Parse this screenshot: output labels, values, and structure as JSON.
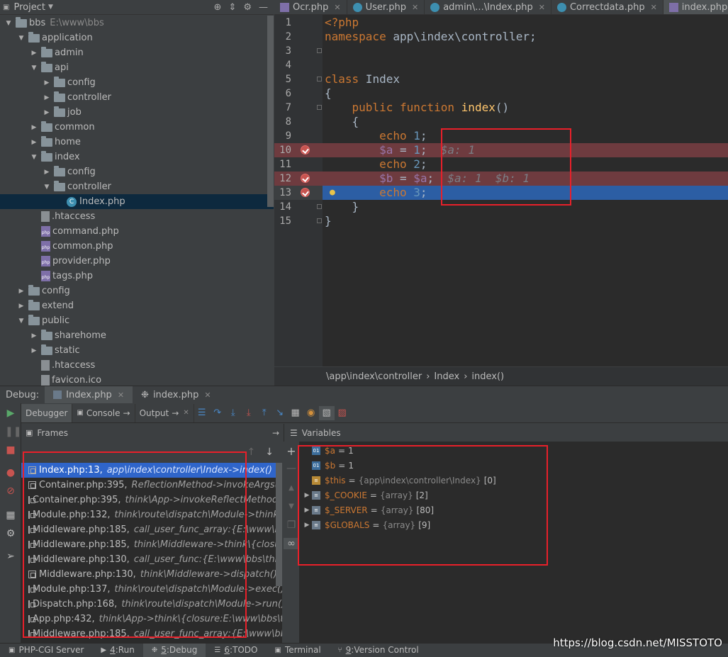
{
  "project": {
    "title": "Project",
    "tree": [
      {
        "label": "bbs",
        "path": "E:\\www\\bbs",
        "kind": "folder",
        "depth": 0,
        "open": true
      },
      {
        "label": "application",
        "kind": "folder",
        "depth": 1,
        "open": true
      },
      {
        "label": "admin",
        "kind": "folder",
        "depth": 2,
        "open": false
      },
      {
        "label": "api",
        "kind": "folder",
        "depth": 2,
        "open": true
      },
      {
        "label": "config",
        "kind": "folder",
        "depth": 3,
        "open": false
      },
      {
        "label": "controller",
        "kind": "folder",
        "depth": 3,
        "open": false
      },
      {
        "label": "job",
        "kind": "folder",
        "depth": 3,
        "open": false
      },
      {
        "label": "common",
        "kind": "folder",
        "depth": 2,
        "open": false
      },
      {
        "label": "home",
        "kind": "folder",
        "depth": 2,
        "open": false
      },
      {
        "label": "index",
        "kind": "folder",
        "depth": 2,
        "open": true
      },
      {
        "label": "config",
        "kind": "folder",
        "depth": 3,
        "open": false
      },
      {
        "label": "controller",
        "kind": "folder",
        "depth": 3,
        "open": true
      },
      {
        "label": "Index.php",
        "kind": "class",
        "depth": 4,
        "selected": true
      },
      {
        "label": ".htaccess",
        "kind": "ht",
        "depth": 2
      },
      {
        "label": "command.php",
        "kind": "php",
        "depth": 2
      },
      {
        "label": "common.php",
        "kind": "php",
        "depth": 2
      },
      {
        "label": "provider.php",
        "kind": "php",
        "depth": 2
      },
      {
        "label": "tags.php",
        "kind": "php",
        "depth": 2
      },
      {
        "label": "config",
        "kind": "folder",
        "depth": 1,
        "open": false
      },
      {
        "label": "extend",
        "kind": "folder",
        "depth": 1,
        "open": false
      },
      {
        "label": "public",
        "kind": "folder",
        "depth": 1,
        "open": true
      },
      {
        "label": "sharehome",
        "kind": "folder",
        "depth": 2,
        "open": false
      },
      {
        "label": "static",
        "kind": "folder",
        "depth": 2,
        "open": false
      },
      {
        "label": ".htaccess",
        "kind": "ht",
        "depth": 2
      },
      {
        "label": "favicon.ico",
        "kind": "ht",
        "depth": 2
      }
    ]
  },
  "editor": {
    "tabs": [
      {
        "label": "Ocr.php",
        "icon": "php",
        "active": false
      },
      {
        "label": "User.php",
        "icon": "c",
        "active": false
      },
      {
        "label": "admin\\...\\Index.php",
        "icon": "c",
        "active": false
      },
      {
        "label": "Correctdata.php",
        "icon": "c",
        "active": false
      },
      {
        "label": "index.php",
        "icon": "php",
        "active": true
      }
    ],
    "lines": [
      {
        "n": "1",
        "html": "<span class='kw'>&lt;?php</span>"
      },
      {
        "n": "2",
        "html": "<span class='kw'>namespace</span> app\\index\\controller;"
      },
      {
        "n": "3",
        "html": ""
      },
      {
        "n": "4",
        "html": ""
      },
      {
        "n": "5",
        "html": "<span class='kw'>class</span> Index"
      },
      {
        "n": "6",
        "html": "{"
      },
      {
        "n": "7",
        "html": "    <span class='kw'>public function</span> <span class='fn'>index</span>()"
      },
      {
        "n": "8",
        "html": "    {"
      },
      {
        "n": "9",
        "html": "        <span class='kw'>echo</span> <span class='num'>1</span>;"
      },
      {
        "n": "10",
        "html": "        <span class='var'>$a</span> = <span class='num'>1</span>;  <span class='inl'>$a: 1</span>",
        "bp": true
      },
      {
        "n": "11",
        "html": "        <span class='kw'>echo</span> <span class='num'>2</span>;"
      },
      {
        "n": "12",
        "html": "        <span class='var'>$b</span> = <span class='var'>$a</span>;  <span class='inl'>$a: 1  $b: 1</span>",
        "bp": true
      },
      {
        "n": "13",
        "html": "        <span class='kw'>echo</span> <span class='num'>3</span>;",
        "cur": true
      },
      {
        "n": "14",
        "html": "    }"
      },
      {
        "n": "15",
        "html": "}"
      }
    ],
    "breadcrumb": [
      "\\app\\index\\controller",
      "Index",
      "index()"
    ]
  },
  "debug": {
    "label": "Debug:",
    "sessions": [
      {
        "label": "Index.php",
        "active": true
      },
      {
        "label": "index.php",
        "active": false
      }
    ],
    "toolbar": {
      "debugger": "Debugger",
      "console": "Console",
      "output": "Output"
    },
    "frames_title": "Frames",
    "variables_title": "Variables",
    "frames": [
      {
        "file": "Index.php:13,",
        "meta": "app\\index\\controller\\Index->index()",
        "selected": true
      },
      {
        "file": "Container.php:395,",
        "meta": "ReflectionMethod->invokeArgs()"
      },
      {
        "file": "Container.php:395,",
        "meta": "think\\App->invokeReflectMethod()"
      },
      {
        "file": "Module.php:132,",
        "meta": "think\\route\\dispatch\\Module->think\\rout"
      },
      {
        "file": "Middleware.php:185,",
        "meta": "call_user_func_array:{E:\\www\\bbs\\thin"
      },
      {
        "file": "Middleware.php:185,",
        "meta": "think\\Middleware->think\\{closure:E:\\"
      },
      {
        "file": "Middleware.php:130,",
        "meta": "call_user_func:{E:\\www\\bbs\\thinkphp\\"
      },
      {
        "file": "Middleware.php:130,",
        "meta": "think\\Middleware->dispatch()"
      },
      {
        "file": "Module.php:137,",
        "meta": "think\\route\\dispatch\\Module->exec()"
      },
      {
        "file": "Dispatch.php:168,",
        "meta": "think\\route\\dispatch\\Module->run()"
      },
      {
        "file": "App.php:432,",
        "meta": "think\\App->think\\{closure:E:\\www\\bbs\\thinkp"
      },
      {
        "file": "Middleware.php:185,",
        "meta": "call_user_func_array:{E:\\www\\bbs\\thin"
      }
    ],
    "variables": [
      {
        "icon": "prim",
        "name": "$a",
        "type": "",
        "value": "1",
        "expandable": false
      },
      {
        "icon": "prim",
        "name": "$b",
        "type": "",
        "value": "1",
        "expandable": false
      },
      {
        "icon": "obj",
        "name": "$this",
        "type": "{app\\index\\controller\\Index}",
        "value": "[0]",
        "expandable": false
      },
      {
        "icon": "arr",
        "name": "$_COOKIE",
        "type": "{array}",
        "value": "[2]",
        "expandable": true
      },
      {
        "icon": "arr",
        "name": "$_SERVER",
        "type": "{array}",
        "value": "[80]",
        "expandable": true
      },
      {
        "icon": "arr",
        "name": "$GLOBALS",
        "type": "{array}",
        "value": "[9]",
        "expandable": true
      }
    ]
  },
  "statusbar": {
    "items": [
      {
        "label": "PHP-CGI Server",
        "key": ""
      },
      {
        "label": "Run",
        "key": "4"
      },
      {
        "label": "Debug",
        "key": "5",
        "active": true
      },
      {
        "label": "TODO",
        "key": "6"
      },
      {
        "label": "Terminal",
        "key": ""
      },
      {
        "label": "Version Control",
        "key": "9"
      }
    ]
  },
  "watermark": "https://blog.csdn.net/MISSTOTO"
}
